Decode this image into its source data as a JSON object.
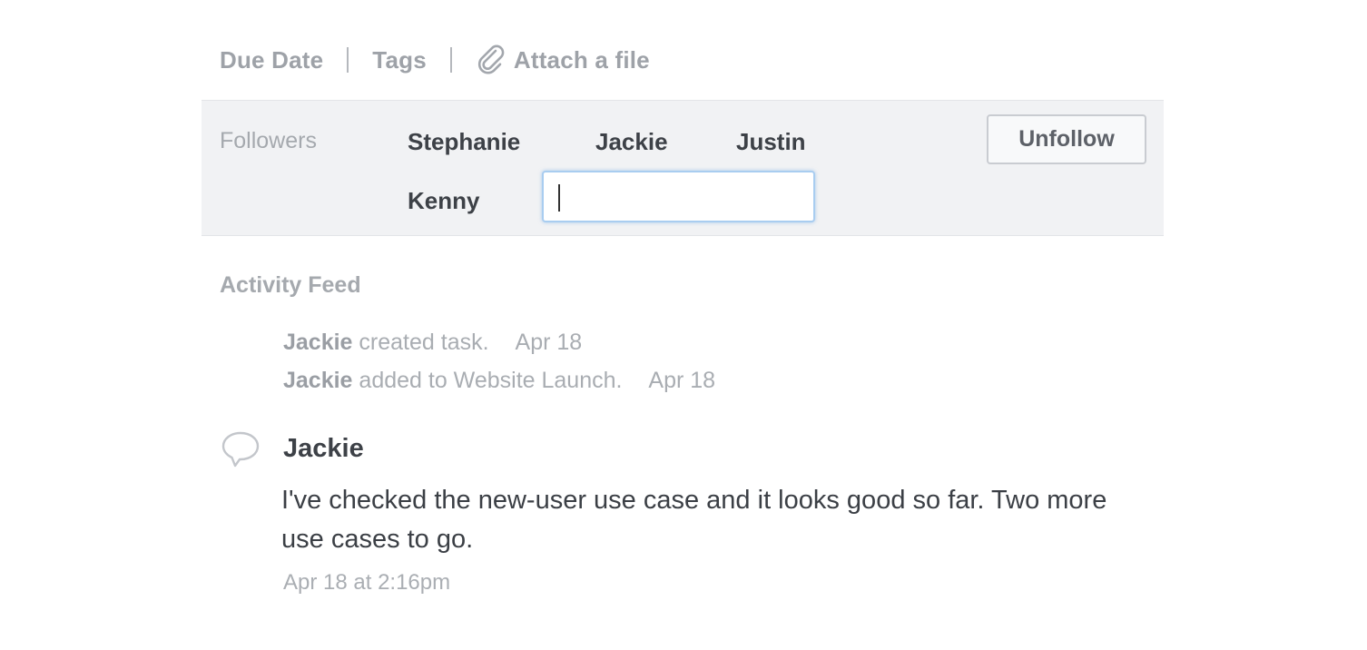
{
  "toolbar": {
    "due_date": "Due Date",
    "tags": "Tags",
    "attach": "Attach a file"
  },
  "followers": {
    "label": "Followers",
    "names": [
      "Stephanie",
      "Jackie",
      "Justin",
      "Kenny"
    ],
    "input_value": "",
    "unfollow_label": "Unfollow"
  },
  "activity": {
    "title": "Activity Feed",
    "stories": [
      {
        "actor": "Jackie",
        "text": "created task.",
        "date": "Apr 18"
      },
      {
        "actor": "Jackie",
        "text": "added to Website Launch.",
        "date": "Apr 18"
      }
    ],
    "comment": {
      "author": "Jackie",
      "text": "I've checked the new-user use case and it looks good so far.  Two more use cases to go.",
      "timestamp": "Apr 18 at 2:16pm",
      "icon": "speech-bubble-icon"
    }
  }
}
